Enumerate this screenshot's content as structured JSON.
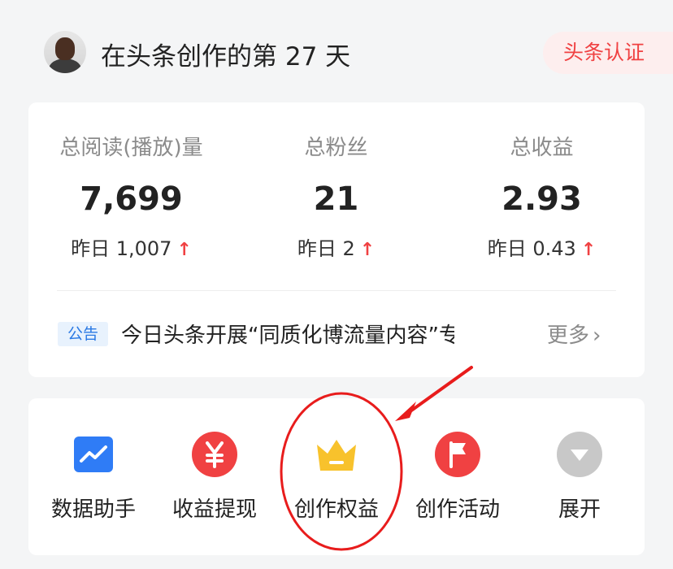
{
  "header": {
    "title": "在头条创作的第 27 天",
    "badge": "头条认证"
  },
  "stats": [
    {
      "label": "总阅读(播放)量",
      "value": "7,699",
      "yesterday": "昨日 1,007"
    },
    {
      "label": "总粉丝",
      "value": "21",
      "yesterday": "昨日 2"
    },
    {
      "label": "总收益",
      "value": "2.93",
      "yesterday": "昨日 0.43"
    }
  ],
  "notice": {
    "tag": "公告",
    "text": "今日头条开展“同质化博流量内容”专...",
    "more": "更多"
  },
  "tools": [
    {
      "label": "数据助手",
      "icon": "chart-icon",
      "color": "#2f7cf6"
    },
    {
      "label": "收益提现",
      "icon": "yuan-icon",
      "color": "#f04142"
    },
    {
      "label": "创作权益",
      "icon": "crown-icon",
      "color": "#f8c22c"
    },
    {
      "label": "创作活动",
      "icon": "flag-icon",
      "color": "#f04142"
    },
    {
      "label": "展开",
      "icon": "chevron-down-icon",
      "color": "#c8c8c8"
    }
  ],
  "colors": {
    "accent_red": "#f04142",
    "accent_blue": "#2f7cf6",
    "crown_yellow": "#f8c22c"
  }
}
